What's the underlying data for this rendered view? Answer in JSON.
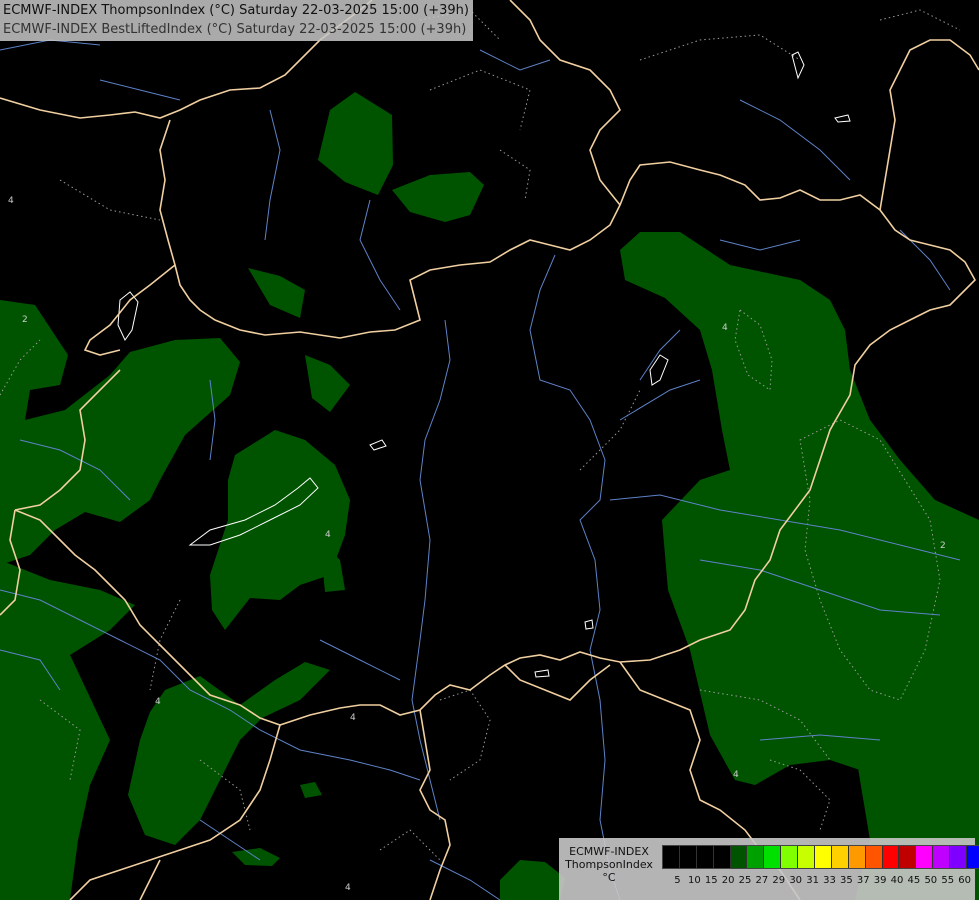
{
  "title": {
    "line1": "ECMWF-INDEX ThompsonIndex (°C) Saturday 22-03-2025 15:00 (+39h)",
    "line2": "ECMWF-INDEX BestLiftedIndex (°C) Saturday 22-03-2025 15:00 (+39h)"
  },
  "map": {
    "background_color": "#000000",
    "field_color": "#005400",
    "border_color": "#f0cfa0",
    "river_color": "#5e82c8",
    "contour_color": "#9a9a9a",
    "contour_labels": [
      "4",
      "4",
      "4",
      "4",
      "4",
      "4",
      "4",
      "2",
      "2"
    ]
  },
  "legend": {
    "title_lines": [
      "ECMWF-INDEX",
      "ThompsonIndex",
      "°C"
    ],
    "labels": [
      "5",
      "10",
      "15",
      "20",
      "25",
      "27",
      "29",
      "30",
      "31",
      "33",
      "35",
      "37",
      "39",
      "40",
      "45",
      "50",
      "55",
      "60"
    ],
    "colors": [
      "#000000",
      "#000000",
      "#000000",
      "#000000",
      "#005400",
      "#00a000",
      "#00e000",
      "#80ff00",
      "#c8ff00",
      "#ffff00",
      "#ffd000",
      "#ff9900",
      "#ff5500",
      "#ff0000",
      "#c00000",
      "#ff00ff",
      "#c000ff",
      "#8000ff",
      "#0000ff"
    ]
  }
}
